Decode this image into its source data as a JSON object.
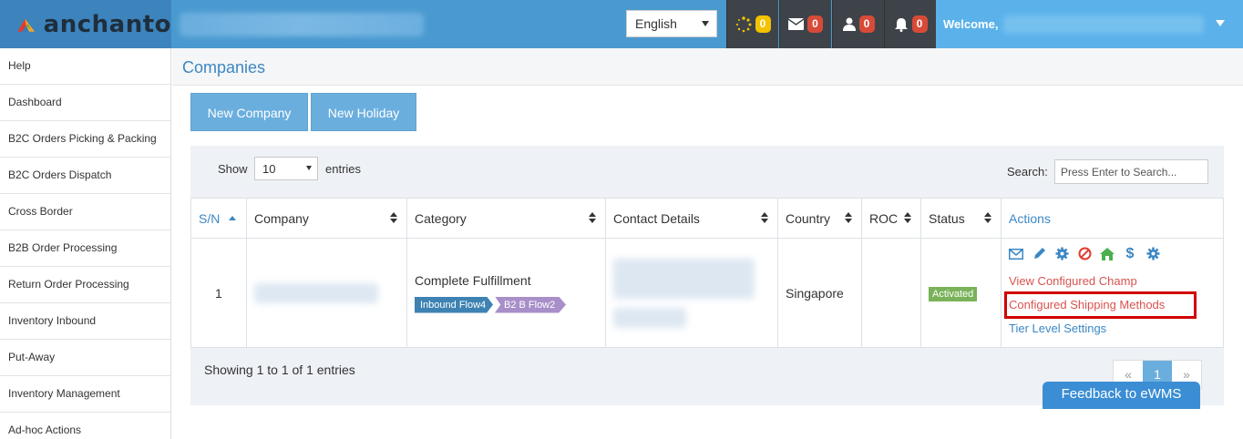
{
  "header": {
    "logo_text": "anchanto",
    "language": "English",
    "notifications": [
      {
        "icon": "spinner-icon",
        "count": "0",
        "color": "#f3c200"
      },
      {
        "icon": "envelope-icon",
        "count": "0",
        "color": "#d84a38"
      },
      {
        "icon": "user-icon",
        "count": "0",
        "color": "#d84a38"
      },
      {
        "icon": "bell-icon",
        "count": "0",
        "color": "#d84a38"
      }
    ],
    "welcome": "Welcome,"
  },
  "sidebar": {
    "items": [
      {
        "label": "Help"
      },
      {
        "label": "Dashboard"
      },
      {
        "label": "B2C Orders Picking & Packing"
      },
      {
        "label": "B2C Orders Dispatch"
      },
      {
        "label": "Cross Border"
      },
      {
        "label": "B2B Order Processing"
      },
      {
        "label": "Return Order Processing"
      },
      {
        "label": "Inventory Inbound"
      },
      {
        "label": "Put-Away"
      },
      {
        "label": "Inventory Management"
      },
      {
        "label": "Ad-hoc Actions"
      }
    ]
  },
  "page": {
    "title": "Companies",
    "buttons": {
      "new_company": "New Company",
      "new_holiday": "New Holiday"
    }
  },
  "table_controls": {
    "show_label": "Show",
    "page_length": "10",
    "entries_label": "entries",
    "search_label": "Search:",
    "search_placeholder": "Press Enter to Search..."
  },
  "table": {
    "columns": [
      "S/N",
      "Company",
      "Category",
      "Contact Details",
      "Country",
      "ROC",
      "Status",
      "Actions"
    ],
    "rows": [
      {
        "sn": "1",
        "category": "Complete Fulfillment",
        "tags": [
          "Inbound Flow4",
          "B2 B Flow2"
        ],
        "country": "Singapore",
        "roc": "",
        "status": "Activated",
        "actions": {
          "links": [
            "View Configured Champ",
            "Configured Shipping Methods",
            "Tier Level Settings"
          ]
        }
      }
    ]
  },
  "footer": {
    "showing": "Showing 1 to 1 of 1 entries",
    "pager": {
      "prev": "«",
      "current": "1",
      "next": "»"
    },
    "feedback": "Feedback to eWMS"
  },
  "colors": {
    "header": "#4a9ad0",
    "accent": "#3b87c4",
    "button": "#6aaede",
    "highlight": "#d00000"
  }
}
